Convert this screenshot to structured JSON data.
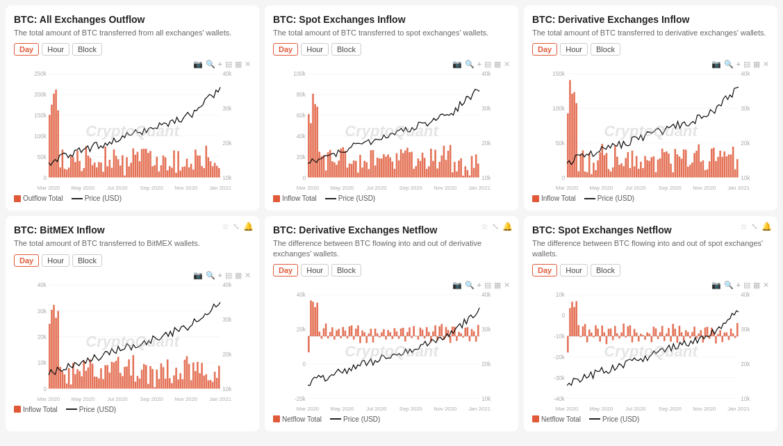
{
  "cards": [
    {
      "id": "btc-all-exchanges-outflow",
      "title": "BTC: All Exchanges Outflow",
      "subtitle": "The total amount of BTC transferred from all exchanges' wallets.",
      "timeBtns": [
        "Day",
        "Hour",
        "Block"
      ],
      "activeBtn": "Day",
      "legend": [
        {
          "type": "box",
          "label": "Outflow Total"
        },
        {
          "type": "line",
          "label": "Price (USD)"
        }
      ],
      "yAxisLeft": [
        "250k",
        "200k",
        "150k",
        "100k",
        "50k",
        "0"
      ],
      "yAxisRight": [
        "40k",
        "30k",
        "20k",
        "10k"
      ],
      "xAxis": [
        "Mar 2020",
        "May 2020",
        "Jul 2020",
        "Sep 2020",
        "Nov 2020",
        "Jan 2021"
      ],
      "chartType": "bar-line",
      "barColor": "#e05a3a",
      "peakLeft": 0.15,
      "hasTopIcons": false
    },
    {
      "id": "btc-spot-exchanges-inflow",
      "title": "BTC: Spot Exchanges Inflow",
      "subtitle": "The total amount of BTC transferred to spot exchanges' wallets.",
      "timeBtns": [
        "Day",
        "Hour",
        "Block"
      ],
      "activeBtn": "Day",
      "legend": [
        {
          "type": "box",
          "label": "Inflow Total"
        },
        {
          "type": "line",
          "label": "Price (USD)"
        }
      ],
      "yAxisLeft": [
        "100k",
        "80k",
        "60k",
        "40k",
        "20k",
        "0"
      ],
      "yAxisRight": [
        "40k",
        "30k",
        "20k",
        "10k"
      ],
      "xAxis": [
        "Mar 2020",
        "May 2020",
        "Jul 2020",
        "Sep 2020",
        "Nov 2020",
        "Jan 2021"
      ],
      "chartType": "bar-line",
      "barColor": "#e05a3a",
      "peakLeft": 0.15,
      "hasTopIcons": false
    },
    {
      "id": "btc-derivative-exchanges-inflow",
      "title": "BTC: Derivative Exchanges Inflow",
      "subtitle": "The total amount of BTC transferred to derivative exchanges' wallets.",
      "timeBtns": [
        "Day",
        "Hour",
        "Block"
      ],
      "activeBtn": "Day",
      "legend": [
        {
          "type": "box",
          "label": "Inflow Total"
        },
        {
          "type": "line",
          "label": "Price (USD)"
        }
      ],
      "yAxisLeft": [
        "150k",
        "100k",
        "50k",
        "0"
      ],
      "yAxisRight": [
        "40k",
        "30k",
        "20k",
        "10k"
      ],
      "xAxis": [
        "Mar 2020",
        "May 2020",
        "Jul 2020",
        "Sep 2020",
        "Nov 2020",
        "Jan 2021"
      ],
      "chartType": "bar-line",
      "barColor": "#e05a3a",
      "peakLeft": 0.15,
      "hasTopIcons": false
    },
    {
      "id": "btc-bitmex-inflow",
      "title": "BTC: BitMEX Inflow",
      "subtitle": "The total amount of BTC transferred to BitMEX wallets.",
      "timeBtns": [
        "Day",
        "Hour",
        "Block"
      ],
      "activeBtn": "Day",
      "legend": [
        {
          "type": "box",
          "label": "Inflow Total"
        },
        {
          "type": "line",
          "label": "Price (USD)"
        }
      ],
      "yAxisLeft": [
        "40k",
        "30k",
        "20k",
        "10k",
        "0"
      ],
      "yAxisRight": [
        "40k",
        "30k",
        "20k",
        "10k"
      ],
      "xAxis": [
        "Mar 2020",
        "May 2020",
        "Jul 2020",
        "Sep 2020",
        "Nov 2020",
        "Jan 2021"
      ],
      "chartType": "bar-line",
      "barColor": "#e05a3a",
      "peakLeft": 0.12,
      "hasTopIcons": true
    },
    {
      "id": "btc-derivative-exchanges-netflow",
      "title": "BTC: Derivative Exchanges Netflow",
      "subtitle": "The difference between BTC flowing into and out of derivative exchanges' wallets.",
      "timeBtns": [
        "Day",
        "Hour",
        "Block"
      ],
      "activeBtn": "Day",
      "legend": [
        {
          "type": "box",
          "label": "Netflow Total"
        },
        {
          "type": "line",
          "label": "Price (USD)"
        }
      ],
      "yAxisLeft": [
        "40k",
        "20k",
        "0",
        "-20k"
      ],
      "yAxisRight": [
        "40k",
        "30k",
        "20k",
        "10k"
      ],
      "xAxis": [
        "Mar 2020",
        "May 2020",
        "Jul 2020",
        "Sep 2020",
        "Nov 2020",
        "Jan 2021"
      ],
      "chartType": "bar-line-mixed",
      "barColor": "#e05a3a",
      "peakLeft": 0.15,
      "hasTopIcons": true
    },
    {
      "id": "btc-spot-exchanges-netflow",
      "title": "BTC: Spot Exchanges Netflow",
      "subtitle": "The difference between BTC flowing into and out of spot exchanges' wallets.",
      "timeBtns": [
        "Day",
        "Hour",
        "Block"
      ],
      "activeBtn": "Day",
      "legend": [
        {
          "type": "box",
          "label": "Netflow Total"
        },
        {
          "type": "line",
          "label": "Price (USD)"
        }
      ],
      "yAxisLeft": [
        "10k",
        "0",
        "-10k",
        "-20k",
        "-30k",
        "-40k"
      ],
      "yAxisRight": [
        "40k",
        "30k",
        "20k",
        "10k"
      ],
      "xAxis": [
        "Mar 2020",
        "May 2020",
        "Jul 2020",
        "Sep 2020",
        "Nov 2020",
        "Jan 2021"
      ],
      "chartType": "bar-line-mixed",
      "barColor": "#e05a3a",
      "peakLeft": 0.15,
      "hasTopIcons": true
    }
  ],
  "watermark": "CryptoQuant",
  "icons": {
    "camera": "📷",
    "zoom": "🔍",
    "plus": "+",
    "download": "⬇",
    "expand": "⤢",
    "close": "✕",
    "star": "☆",
    "resize": "⤡",
    "bell": "🔔"
  }
}
